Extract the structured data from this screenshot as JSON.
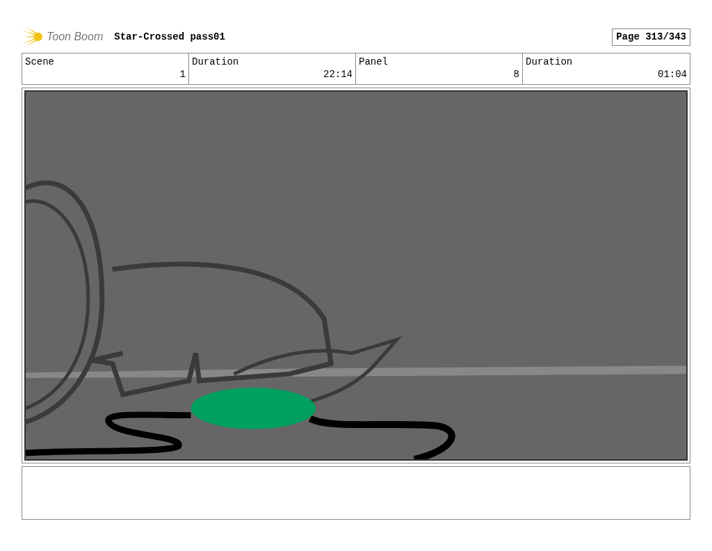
{
  "header": {
    "logo_text": "Toon Boom",
    "title": "Star-Crossed pass01",
    "page": "Page 313/343"
  },
  "info_table": {
    "columns": [
      {
        "heading": "Scene",
        "entry": "1"
      },
      {
        "heading": "Duration",
        "entry": "22:14"
      },
      {
        "heading": "Panel",
        "entry": "8"
      },
      {
        "heading": "Duration",
        "entry": "01:04"
      }
    ]
  }
}
